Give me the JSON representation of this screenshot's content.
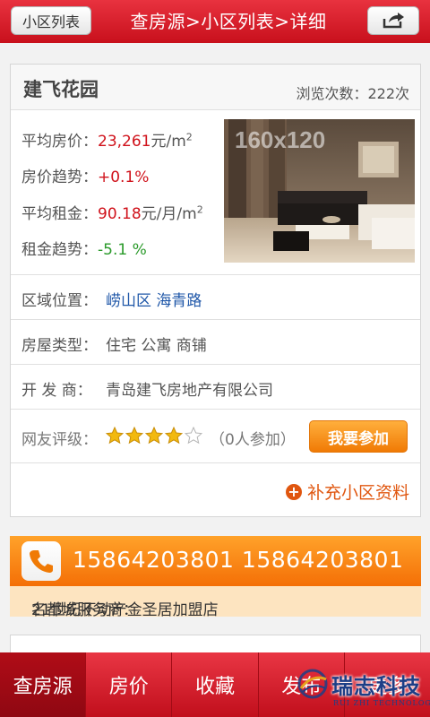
{
  "header": {
    "back_label": "小区列表",
    "title": "查房源>小区列表>详细",
    "share_icon": "share-icon"
  },
  "community": {
    "name": "建飞花园",
    "views_label": "浏览次数：",
    "views_count": "222次",
    "avg_price_label": "平均房价：",
    "avg_price_value": "23,261",
    "avg_price_unit": "元/m",
    "price_trend_label": "房价趋势：",
    "price_trend_value": "+0.1%",
    "avg_rent_label": "平均租金：",
    "avg_rent_value": "90.18",
    "avg_rent_unit": "元/月/m",
    "rent_trend_label": "租金趋势：",
    "rent_trend_value": "-5.1 %",
    "photo_placeholder": "160x120",
    "location_label": "区域位置：",
    "district": "崂山区",
    "road": "海青路",
    "house_type_label": "房屋类型：",
    "house_types": "住宅 公寓 商铺",
    "developer_label": "开 发 商：",
    "developer": "青岛建飞房地产有限公司",
    "rating_label": "网友评级：",
    "rating_stars": 4,
    "rating_max": 5,
    "rating_count": "（0人参加）",
    "join_label": "我要参加",
    "supplement_label": "补充小区资料"
  },
  "contact": {
    "phones": "15864203801  15864203801",
    "provider_label": "名都城服务商：",
    "provider": "21世纪不动产金圣居加盟店"
  },
  "tabs": [
    {
      "label": "查房源",
      "active": true
    },
    {
      "label": "房价",
      "active": false
    },
    {
      "label": "收藏",
      "active": false
    },
    {
      "label": "发布",
      "active": false
    },
    {
      "label": "更多",
      "active": false
    }
  ],
  "watermark": {
    "text": "瑞志科技",
    "sub": "RUI ZHI TECHNOLOGY"
  },
  "colors": {
    "brand_red": "#d0121b",
    "accent_orange": "#f07a05",
    "link_blue": "#1f57a8",
    "trend_green": "#2a9a2a"
  }
}
